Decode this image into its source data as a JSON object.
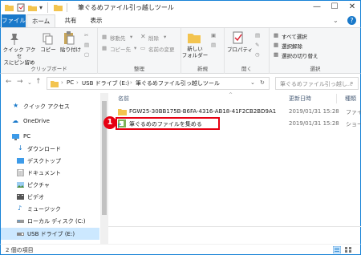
{
  "window": {
    "title": "筆ぐるめファイル引っ越しツール",
    "controls": [
      "—",
      "☐",
      "✕"
    ]
  },
  "ribbon_tabs": [
    "ファイル",
    "ホーム",
    "共有",
    "表示"
  ],
  "ribbon": {
    "clipboard": {
      "pin_label_1": "クイック アクセ",
      "pin_label_2": "スにピン留め",
      "copy": "コピー",
      "paste": "貼り付け",
      "group": "クリップボード"
    },
    "organize": {
      "move_to": "移動先",
      "copy_to": "コピー先",
      "delete": "削除",
      "rename": "名前の変更",
      "group": "整理"
    },
    "new": {
      "new_folder_1": "新しい",
      "new_folder_2": "フォルダー",
      "group": "新規"
    },
    "open": {
      "properties": "プロパティ",
      "group": "開く"
    },
    "select": {
      "select_all": "すべて選択",
      "select_none": "選択解除",
      "invert": "選択の切り替え",
      "group": "選択"
    }
  },
  "address": {
    "crumbs": [
      "PC",
      "USB ドライブ (E:)",
      "筆ぐるめファイル引っ越しツール"
    ],
    "search_placeholder": "筆ぐるめファイル引っ越し..."
  },
  "nav": {
    "items": [
      {
        "label": "クイック アクセス",
        "icon": "star-icon"
      },
      {
        "label": "OneDrive",
        "icon": "cloud-icon"
      },
      {
        "label": "PC",
        "icon": "pc-icon"
      },
      {
        "label": "ダウンロード",
        "icon": "download-icon"
      },
      {
        "label": "デスクトップ",
        "icon": "desktop-icon"
      },
      {
        "label": "ドキュメント",
        "icon": "document-icon"
      },
      {
        "label": "ピクチャ",
        "icon": "picture-icon"
      },
      {
        "label": "ビデオ",
        "icon": "video-icon"
      },
      {
        "label": "ミュージック",
        "icon": "music-icon"
      },
      {
        "label": "ローカル ディスク (C:)",
        "icon": "disk-icon"
      },
      {
        "label": "USB ドライブ (E:)",
        "icon": "usb-icon"
      }
    ]
  },
  "content": {
    "columns": {
      "name": "名前",
      "date": "更新日時",
      "kind": "種類"
    },
    "rows": [
      {
        "name": "FGW25-30BB175B-B6FA-4316-AB18-41F2CB2BD9A1",
        "date": "2019/01/31 15:28",
        "kind": "ファイル",
        "icon": "folder-icon"
      },
      {
        "name": "筆ぐるめのファイルを集める",
        "date": "2019/01/31 15:28",
        "kind": "ショート",
        "icon": "shortcut-icon"
      }
    ],
    "marker": "1"
  },
  "status": {
    "text": "2 個の項目"
  },
  "colors": {
    "accent": "#1979ca",
    "highlight": "#e60012",
    "selection": "#cce8ff"
  }
}
